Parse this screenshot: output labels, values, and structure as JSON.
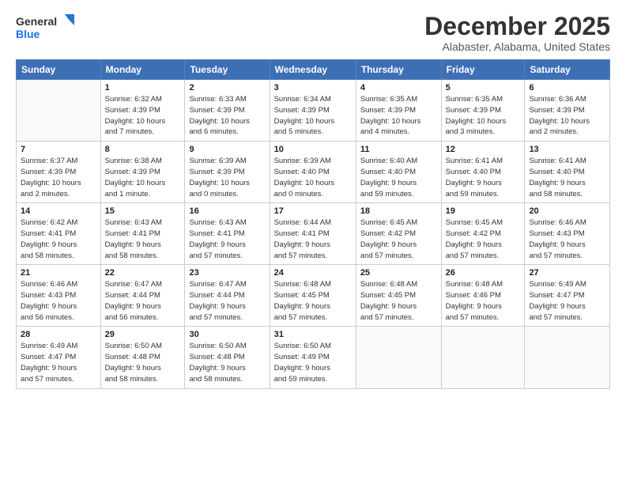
{
  "logo": {
    "line1": "General",
    "line2": "Blue"
  },
  "title": "December 2025",
  "location": "Alabaster, Alabama, United States",
  "days_header": [
    "Sunday",
    "Monday",
    "Tuesday",
    "Wednesday",
    "Thursday",
    "Friday",
    "Saturday"
  ],
  "weeks": [
    [
      {
        "num": "",
        "info": ""
      },
      {
        "num": "1",
        "info": "Sunrise: 6:32 AM\nSunset: 4:39 PM\nDaylight: 10 hours\nand 7 minutes."
      },
      {
        "num": "2",
        "info": "Sunrise: 6:33 AM\nSunset: 4:39 PM\nDaylight: 10 hours\nand 6 minutes."
      },
      {
        "num": "3",
        "info": "Sunrise: 6:34 AM\nSunset: 4:39 PM\nDaylight: 10 hours\nand 5 minutes."
      },
      {
        "num": "4",
        "info": "Sunrise: 6:35 AM\nSunset: 4:39 PM\nDaylight: 10 hours\nand 4 minutes."
      },
      {
        "num": "5",
        "info": "Sunrise: 6:35 AM\nSunset: 4:39 PM\nDaylight: 10 hours\nand 3 minutes."
      },
      {
        "num": "6",
        "info": "Sunrise: 6:36 AM\nSunset: 4:39 PM\nDaylight: 10 hours\nand 2 minutes."
      }
    ],
    [
      {
        "num": "7",
        "info": "Sunrise: 6:37 AM\nSunset: 4:39 PM\nDaylight: 10 hours\nand 2 minutes."
      },
      {
        "num": "8",
        "info": "Sunrise: 6:38 AM\nSunset: 4:39 PM\nDaylight: 10 hours\nand 1 minute."
      },
      {
        "num": "9",
        "info": "Sunrise: 6:39 AM\nSunset: 4:39 PM\nDaylight: 10 hours\nand 0 minutes."
      },
      {
        "num": "10",
        "info": "Sunrise: 6:39 AM\nSunset: 4:40 PM\nDaylight: 10 hours\nand 0 minutes."
      },
      {
        "num": "11",
        "info": "Sunrise: 6:40 AM\nSunset: 4:40 PM\nDaylight: 9 hours\nand 59 minutes."
      },
      {
        "num": "12",
        "info": "Sunrise: 6:41 AM\nSunset: 4:40 PM\nDaylight: 9 hours\nand 59 minutes."
      },
      {
        "num": "13",
        "info": "Sunrise: 6:41 AM\nSunset: 4:40 PM\nDaylight: 9 hours\nand 58 minutes."
      }
    ],
    [
      {
        "num": "14",
        "info": "Sunrise: 6:42 AM\nSunset: 4:41 PM\nDaylight: 9 hours\nand 58 minutes."
      },
      {
        "num": "15",
        "info": "Sunrise: 6:43 AM\nSunset: 4:41 PM\nDaylight: 9 hours\nand 58 minutes."
      },
      {
        "num": "16",
        "info": "Sunrise: 6:43 AM\nSunset: 4:41 PM\nDaylight: 9 hours\nand 57 minutes."
      },
      {
        "num": "17",
        "info": "Sunrise: 6:44 AM\nSunset: 4:41 PM\nDaylight: 9 hours\nand 57 minutes."
      },
      {
        "num": "18",
        "info": "Sunrise: 6:45 AM\nSunset: 4:42 PM\nDaylight: 9 hours\nand 57 minutes."
      },
      {
        "num": "19",
        "info": "Sunrise: 6:45 AM\nSunset: 4:42 PM\nDaylight: 9 hours\nand 57 minutes."
      },
      {
        "num": "20",
        "info": "Sunrise: 6:46 AM\nSunset: 4:43 PM\nDaylight: 9 hours\nand 57 minutes."
      }
    ],
    [
      {
        "num": "21",
        "info": "Sunrise: 6:46 AM\nSunset: 4:43 PM\nDaylight: 9 hours\nand 56 minutes."
      },
      {
        "num": "22",
        "info": "Sunrise: 6:47 AM\nSunset: 4:44 PM\nDaylight: 9 hours\nand 56 minutes."
      },
      {
        "num": "23",
        "info": "Sunrise: 6:47 AM\nSunset: 4:44 PM\nDaylight: 9 hours\nand 57 minutes."
      },
      {
        "num": "24",
        "info": "Sunrise: 6:48 AM\nSunset: 4:45 PM\nDaylight: 9 hours\nand 57 minutes."
      },
      {
        "num": "25",
        "info": "Sunrise: 6:48 AM\nSunset: 4:45 PM\nDaylight: 9 hours\nand 57 minutes."
      },
      {
        "num": "26",
        "info": "Sunrise: 6:48 AM\nSunset: 4:46 PM\nDaylight: 9 hours\nand 57 minutes."
      },
      {
        "num": "27",
        "info": "Sunrise: 6:49 AM\nSunset: 4:47 PM\nDaylight: 9 hours\nand 57 minutes."
      }
    ],
    [
      {
        "num": "28",
        "info": "Sunrise: 6:49 AM\nSunset: 4:47 PM\nDaylight: 9 hours\nand 57 minutes."
      },
      {
        "num": "29",
        "info": "Sunrise: 6:50 AM\nSunset: 4:48 PM\nDaylight: 9 hours\nand 58 minutes."
      },
      {
        "num": "30",
        "info": "Sunrise: 6:50 AM\nSunset: 4:48 PM\nDaylight: 9 hours\nand 58 minutes."
      },
      {
        "num": "31",
        "info": "Sunrise: 6:50 AM\nSunset: 4:49 PM\nDaylight: 9 hours\nand 59 minutes."
      },
      {
        "num": "",
        "info": ""
      },
      {
        "num": "",
        "info": ""
      },
      {
        "num": "",
        "info": ""
      }
    ]
  ]
}
